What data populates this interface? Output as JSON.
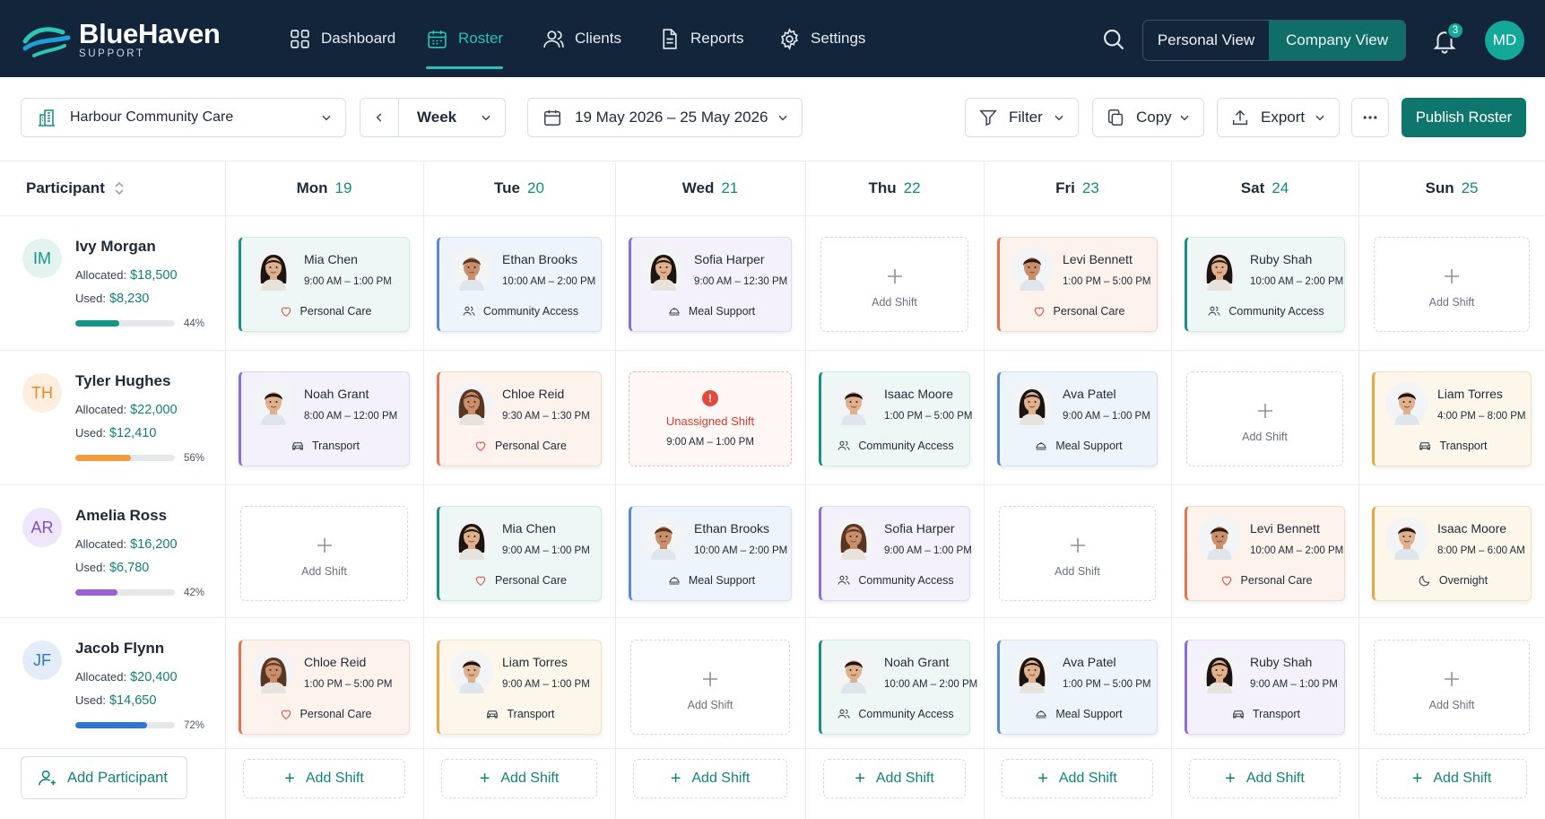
{
  "app": {
    "name": "BlueHaven",
    "tagline": "SUPPORT"
  },
  "nav": {
    "items": [
      {
        "label": "Dashboard",
        "icon": "grid-icon"
      },
      {
        "label": "Roster",
        "icon": "calendar-icon",
        "active": true
      },
      {
        "label": "Clients",
        "icon": "users-icon"
      },
      {
        "label": "Reports",
        "icon": "document-icon"
      },
      {
        "label": "Settings",
        "icon": "gear-icon"
      }
    ],
    "view_personal": "Personal View",
    "view_company": "Company View",
    "active_view": "Company View",
    "notifications": "3",
    "user_initials": "MD"
  },
  "toolbar": {
    "organization": "Harbour Community Care",
    "period": "Week",
    "date_range": "19 May 2026 – 25 May 2026",
    "filter": "Filter",
    "copy": "Copy",
    "export": "Export",
    "publish": "Publish Roster"
  },
  "grid": {
    "participant_header": "Participant",
    "days": [
      {
        "day": "Mon",
        "num": "19"
      },
      {
        "day": "Tue",
        "num": "20"
      },
      {
        "day": "Wed",
        "num": "21"
      },
      {
        "day": "Thu",
        "num": "22"
      },
      {
        "day": "Fri",
        "num": "23"
      },
      {
        "day": "Sat",
        "num": "24"
      },
      {
        "day": "Sun",
        "num": "25"
      }
    ],
    "add_shift": "Add Shift",
    "footer_add_shift": "Add Shift",
    "add_participant": "Add Participant",
    "allocated_label": "Allocated:",
    "used_label": "Used:",
    "unassigned_label": "Unassigned Shift"
  },
  "participants": [
    {
      "initials": "IM",
      "name": "Ivy Morgan",
      "allocated": "$18,500",
      "used": "$8,230",
      "pct_label": "44%",
      "pct": 0.44,
      "color": "#13968a",
      "bg": "#e2f3f0",
      "fg": "#13968a"
    },
    {
      "initials": "TH",
      "name": "Tyler Hughes",
      "allocated": "$22,000",
      "used": "$12,410",
      "pct_label": "56%",
      "pct": 0.56,
      "color": "#f39a3d",
      "bg": "#fdeedd",
      "fg": "#e38a2d"
    },
    {
      "initials": "AR",
      "name": "Amelia Ross",
      "allocated": "$16,200",
      "used": "$6,780",
      "pct_label": "42%",
      "pct": 0.42,
      "color": "#9b5fd6",
      "bg": "#efe6fb",
      "fg": "#7f4fc4"
    },
    {
      "initials": "JF",
      "name": "Jacob Flynn",
      "allocated": "$20,400",
      "used": "$14,650",
      "pct_label": "72%",
      "pct": 0.72,
      "color": "#2f74d0",
      "bg": "#e3edfa",
      "fg": "#2f74d0"
    }
  ],
  "shifts": [
    [
      {
        "type": "shift",
        "name": "Mia Chen",
        "time": "9:00 AM – 1:00 PM",
        "service": "Personal Care",
        "service_icon": "heart-icon",
        "color": "mint",
        "person": "female-dark"
      },
      {
        "type": "shift",
        "name": "Ethan Brooks",
        "time": "10:00 AM – 2:00 PM",
        "service": "Community Access",
        "service_icon": "people-icon",
        "color": "blue",
        "person": "male-brown"
      },
      {
        "type": "shift",
        "name": "Sofia Harper",
        "time": "9:00 AM – 12:30 PM",
        "service": "Meal Support",
        "service_icon": "dish-icon",
        "color": "lav",
        "person": "female-dark"
      },
      {
        "type": "add"
      },
      {
        "type": "shift",
        "name": "Levi Bennett",
        "time": "1:00 PM – 5:00 PM",
        "service": "Personal Care",
        "service_icon": "heart-icon",
        "color": "peach",
        "person": "male-curly"
      },
      {
        "type": "shift",
        "name": "Ruby Shah",
        "time": "10:00 AM – 2:00 PM",
        "service": "Community Access",
        "service_icon": "people-icon",
        "color": "mint",
        "person": "female-dark"
      },
      {
        "type": "add"
      }
    ],
    [
      {
        "type": "shift",
        "name": "Noah Grant",
        "time": "8:00 AM – 12:00 PM",
        "service": "Transport",
        "service_icon": "car-icon",
        "color": "lav",
        "person": "male-dark"
      },
      {
        "type": "shift",
        "name": "Chloe Reid",
        "time": "9:30 AM – 1:30 PM",
        "service": "Personal Care",
        "service_icon": "heart-icon",
        "color": "peach",
        "person": "female-brown"
      },
      {
        "type": "unassigned",
        "time": "9:00 AM – 1:00 PM"
      },
      {
        "type": "shift",
        "name": "Isaac Moore",
        "time": "1:00 PM – 5:00 PM",
        "service": "Community Access",
        "service_icon": "people-icon",
        "color": "mint",
        "person": "male-dark"
      },
      {
        "type": "shift",
        "name": "Ava Patel",
        "time": "9:00 AM – 1:00 PM",
        "service": "Meal Support",
        "service_icon": "dish-icon",
        "color": "blue",
        "person": "female-dark"
      },
      {
        "type": "add"
      },
      {
        "type": "shift",
        "name": "Liam Torres",
        "time": "4:00 PM – 8:00 PM",
        "service": "Transport",
        "service_icon": "car-icon",
        "color": "cream",
        "person": "male-dark"
      }
    ],
    [
      {
        "type": "add"
      },
      {
        "type": "shift",
        "name": "Mia Chen",
        "time": "9:00 AM – 1:00 PM",
        "service": "Personal Care",
        "service_icon": "heart-icon",
        "color": "mint",
        "person": "female-dark"
      },
      {
        "type": "shift",
        "name": "Ethan Brooks",
        "time": "10:00 AM – 2:00 PM",
        "service": "Meal Support",
        "service_icon": "dish-icon",
        "color": "blue",
        "person": "male-brown"
      },
      {
        "type": "shift",
        "name": "Sofia Harper",
        "time": "9:00 AM – 1:00 PM",
        "service": "Community Access",
        "service_icon": "people-icon",
        "color": "lav",
        "person": "female-brown"
      },
      {
        "type": "add"
      },
      {
        "type": "shift",
        "name": "Levi Bennett",
        "time": "10:00 AM – 2:00 PM",
        "service": "Personal Care",
        "service_icon": "heart-icon",
        "color": "peach",
        "person": "male-curly"
      },
      {
        "type": "shift",
        "name": "Isaac Moore",
        "time": "8:00 PM – 6:00 AM",
        "service": "Overnight",
        "service_icon": "moon-icon",
        "color": "cream",
        "person": "male-dark"
      }
    ],
    [
      {
        "type": "shift",
        "name": "Chloe Reid",
        "time": "1:00 PM – 5:00 PM",
        "service": "Personal Care",
        "service_icon": "heart-icon",
        "color": "peach",
        "person": "female-brown"
      },
      {
        "type": "shift",
        "name": "Liam Torres",
        "time": "9:00 AM – 1:00 PM",
        "service": "Transport",
        "service_icon": "car-icon",
        "color": "cream",
        "person": "male-dark"
      },
      {
        "type": "add"
      },
      {
        "type": "shift",
        "name": "Noah Grant",
        "time": "10:00 AM – 2:00 PM",
        "service": "Community Access",
        "service_icon": "people-icon",
        "color": "mint",
        "person": "male-dark"
      },
      {
        "type": "shift",
        "name": "Ava Patel",
        "time": "1:00 PM – 5:00 PM",
        "service": "Meal Support",
        "service_icon": "dish-icon",
        "color": "blue",
        "person": "female-dark"
      },
      {
        "type": "shift",
        "name": "Ruby Shah",
        "time": "9:00 AM – 1:00 PM",
        "service": "Transport",
        "service_icon": "car-icon",
        "color": "lav",
        "person": "female-dark"
      },
      {
        "type": "add"
      }
    ]
  ]
}
